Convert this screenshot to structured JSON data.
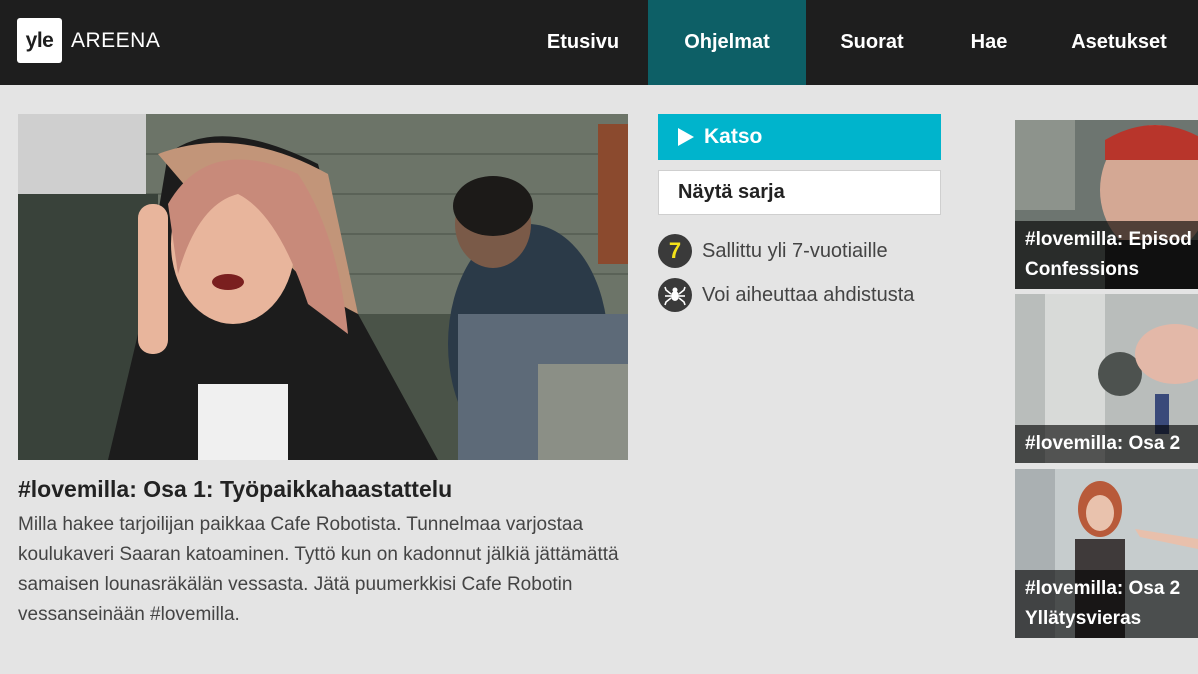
{
  "brand": {
    "logo": "yle",
    "name": "AREENA"
  },
  "nav": {
    "items": [
      {
        "label": "Etusivu",
        "active": false
      },
      {
        "label": "Ohjelmat",
        "active": true
      },
      {
        "label": "Suorat",
        "active": false
      },
      {
        "label": "Hae",
        "active": false
      },
      {
        "label": "Asetukset",
        "active": false
      }
    ]
  },
  "episode": {
    "title": "#lovemilla: Osa 1: Työpaikkahaastattelu",
    "description": "Milla hakee tarjoilijan paikkaa Cafe Robotista. Tunnelmaa varjostaa koulukaveri Saaran katoaminen. Tyttö kun on kadonnut jälkiä jättämättä samaisen lounasräkälän vessasta. Jätä puumerkkisi Cafe Robotin vessanseinään #lovemilla."
  },
  "actions": {
    "watch_label": "Katso",
    "series_label": "Näytä sarja"
  },
  "ratings": [
    {
      "badge": "7",
      "text": "Sallittu yli 7-vuotiaille",
      "icon": "age-7-icon"
    },
    {
      "badge": "",
      "text": "Voi aiheuttaa ahdistusta",
      "icon": "spider-icon"
    }
  ],
  "related": [
    {
      "line1": "#lovemilla: Episod",
      "line2": "Confessions"
    },
    {
      "line1": "#lovemilla: Osa 2",
      "line2": ""
    },
    {
      "line1": "#lovemilla: Osa 2",
      "line2": "Yllätysvieras"
    }
  ],
  "colors": {
    "topbar": "#1e1e1e",
    "nav_active": "#0d5f66",
    "watch_button": "#00b4cc",
    "age_badge_text": "#f4e21a"
  }
}
